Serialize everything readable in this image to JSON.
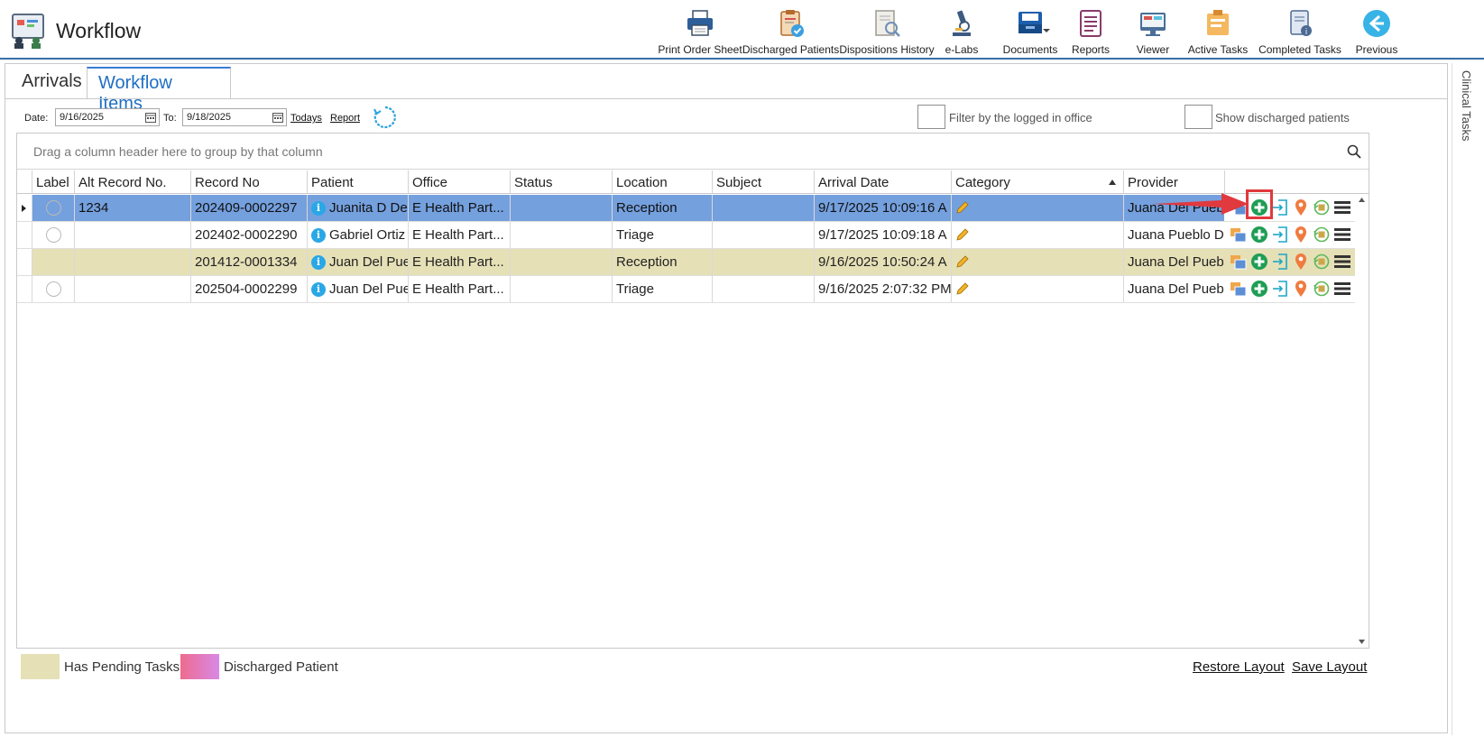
{
  "app": {
    "title": "Workflow",
    "logo_icon": "workflow-logo-icon"
  },
  "toolbar": [
    {
      "label": "Print Order Sheet",
      "icon": "printer-icon"
    },
    {
      "label": "Discharged Patients",
      "icon": "clipboard-check-icon"
    },
    {
      "label": "Dispositions History",
      "icon": "document-search-icon"
    },
    {
      "label": "e-Labs",
      "icon": "microscope-icon"
    },
    {
      "label": "Documents",
      "icon": "documents-tray-icon"
    },
    {
      "label": "Reports",
      "icon": "report-list-icon"
    },
    {
      "label": "Viewer",
      "icon": "viewer-screen-icon"
    },
    {
      "label": "Active Tasks",
      "icon": "active-tasks-icon"
    },
    {
      "label": "Completed Tasks",
      "icon": "completed-tasks-icon"
    },
    {
      "label": "Previous",
      "icon": "back-arrow-icon"
    }
  ],
  "tabs": [
    {
      "label": "Arrivals",
      "active": false
    },
    {
      "label": "Workflow Items",
      "active": true
    }
  ],
  "filters": {
    "date_label": "Date:",
    "date_from": "9/16/2025",
    "to_label": "To:",
    "date_to": "9/18/2025",
    "todays_link": "Todays",
    "report_link": "Report",
    "filter_office_label": "Filter by the logged in office",
    "filter_office_checked": false,
    "show_discharged_label": "Show discharged patients",
    "show_discharged_checked": false
  },
  "grid": {
    "group_hint": "Drag a column header here to group by that column",
    "columns": [
      "Label",
      "Alt Record No.",
      "Record No",
      "Patient",
      "Office",
      "Status",
      "Location",
      "Subject",
      "Arrival Date",
      "Category",
      "Provider"
    ],
    "sorted_column": "Category",
    "sort_direction": "ascending",
    "rows": [
      {
        "label": "",
        "alt_record": "1234",
        "record_no": "202409-0002297",
        "patient": "Juanita D De",
        "office": "E Health Part...",
        "status": "",
        "location": "Reception",
        "subject": "",
        "arrival_date": "9/17/2025 10:09:16 A",
        "category": "",
        "provider": "Juana Del Pueb",
        "state": "selected"
      },
      {
        "label": "",
        "alt_record": "",
        "record_no": "202402-0002290",
        "patient": "Gabriel Ortiz",
        "office": "E Health Part...",
        "status": "",
        "location": "Triage",
        "subject": "",
        "arrival_date": "9/17/2025 10:09:18 A",
        "category": "",
        "provider": "Juana Pueblo De",
        "state": "plain"
      },
      {
        "label": "",
        "alt_record": "",
        "record_no": "201412-0001334",
        "patient": "Juan Del Pue",
        "office": "E Health Part...",
        "status": "",
        "location": "Reception",
        "subject": "",
        "arrival_date": "9/16/2025 10:50:24 A",
        "category": "",
        "provider": "Juana Del Pueblo",
        "state": "pending"
      },
      {
        "label": "",
        "alt_record": "",
        "record_no": "202504-0002299",
        "patient": "Juan Del Pue",
        "office": "E Health Part...",
        "status": "",
        "location": "Triage",
        "subject": "",
        "arrival_date": "9/16/2025 2:07:32 PM",
        "category": "",
        "provider": "Juana Del Pueblo",
        "state": "plain"
      }
    ]
  },
  "legend": [
    {
      "label": "Has Pending Tasks",
      "color": "#e6e0b7"
    },
    {
      "label": "Discharged Patient",
      "color": "#e8719f"
    }
  ],
  "footer": {
    "restore_label": "Restore Layout",
    "save_label": "Save Layout"
  },
  "right_rail": {
    "label": "Clinical Tasks"
  },
  "colors": {
    "accent": "#1f6fc4",
    "selected_row": "#74a0de",
    "pending_row": "#e6e0b7",
    "highlight": "#e0393e"
  }
}
